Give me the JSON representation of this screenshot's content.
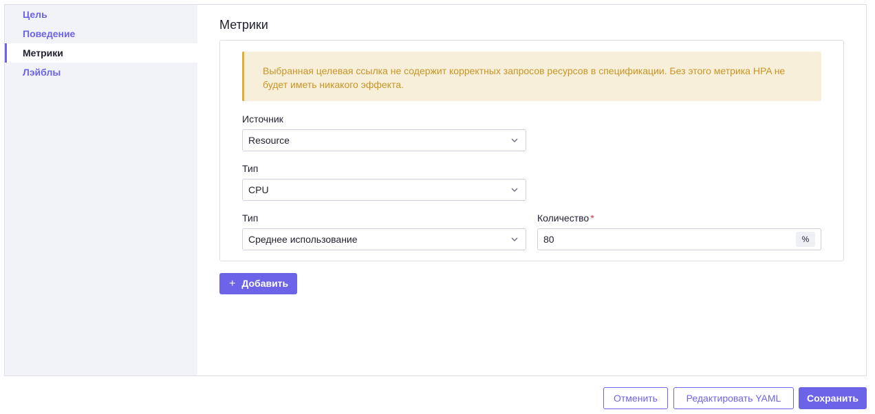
{
  "sidebar": {
    "items": [
      {
        "label": "Цель",
        "active": false
      },
      {
        "label": "Поведение",
        "active": false
      },
      {
        "label": "Метрики",
        "active": true
      },
      {
        "label": "Лэйблы",
        "active": false
      }
    ]
  },
  "main": {
    "title": "Метрики",
    "banner": "Выбранная целевая ссылка не содержит корректных запросов ресурсов в спецификации. Без этого метрика HPA не будет иметь никакого эффекта.",
    "source": {
      "label": "Источник",
      "value": "Resource"
    },
    "type1": {
      "label": "Тип",
      "value": "CPU"
    },
    "type2": {
      "label": "Тип",
      "value": "Среднее использование"
    },
    "quantity": {
      "label": "Количество",
      "required_mark": "*",
      "value": "80",
      "suffix": "%"
    },
    "add_label": "Добавить"
  },
  "footer": {
    "cancel_label": "Отменить",
    "edit_yaml_label": "Редактировать YAML",
    "save_label": "Сохранить"
  },
  "colors": {
    "accent": "#6c63e8",
    "warning_bg": "#f7efd9",
    "warning_text": "#c99424"
  }
}
